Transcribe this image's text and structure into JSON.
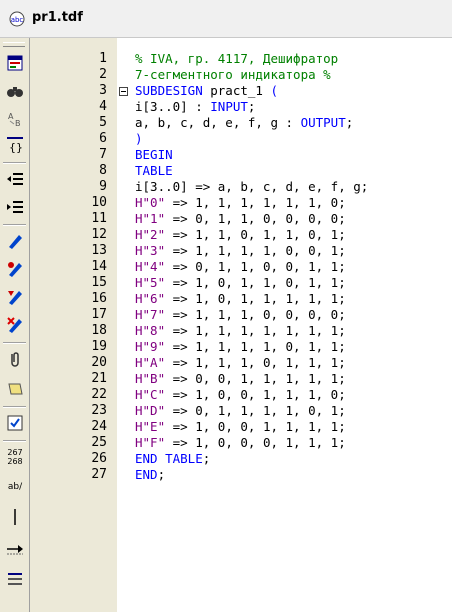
{
  "window": {
    "title": "pr1.tdf"
  },
  "toolbar": {
    "icons": [
      "document-icon",
      "find-icon",
      "find-replace-icon",
      "brackets-icon",
      "indent-icon",
      "unindent-icon",
      "pen-icon",
      "symbol-a-icon",
      "symbol-b-icon",
      "delete-icon",
      "clip-icon",
      "scroll-icon",
      "check-icon",
      "counter-icon",
      "ab-icon",
      "divider-icon",
      "arrow-icon",
      "list-icon"
    ],
    "counter_top": "267",
    "counter_bottom": "268",
    "ab_label": "ab/"
  },
  "editor": {
    "lines": [
      {
        "num": "1",
        "text": "% IVA, гр. 4117, Дешифратор"
      },
      {
        "num": "2",
        "text": "7-сегментного индикатора %"
      },
      {
        "num": "3",
        "text": "SUBDESIGN pract_1 ("
      },
      {
        "num": "4",
        "text": "i[3..0] : INPUT;"
      },
      {
        "num": "5",
        "text": "a, b, c, d, e, f, g : OUTPUT;"
      },
      {
        "num": "6",
        "text": ")"
      },
      {
        "num": "7",
        "text": "BEGIN"
      },
      {
        "num": "8",
        "text": "TABLE"
      },
      {
        "num": "9",
        "text": "i[3..0] => a, b, c, d, e, f, g;"
      },
      {
        "num": "10",
        "text": "H\"0\" => 1, 1, 1, 1, 1, 1, 0;"
      },
      {
        "num": "11",
        "text": "H\"1\" => 0, 1, 1, 0, 0, 0, 0;"
      },
      {
        "num": "12",
        "text": "H\"2\" => 1, 1, 0, 1, 1, 0, 1;"
      },
      {
        "num": "13",
        "text": "H\"3\" => 1, 1, 1, 1, 0, 0, 1;"
      },
      {
        "num": "14",
        "text": "H\"4\" => 0, 1, 1, 0, 0, 1, 1;"
      },
      {
        "num": "15",
        "text": "H\"5\" => 1, 0, 1, 1, 0, 1, 1;"
      },
      {
        "num": "16",
        "text": "H\"6\" => 1, 0, 1, 1, 1, 1, 1;"
      },
      {
        "num": "17",
        "text": "H\"7\" => 1, 1, 1, 0, 0, 0, 0;"
      },
      {
        "num": "18",
        "text": "H\"8\" => 1, 1, 1, 1, 1, 1, 1;"
      },
      {
        "num": "19",
        "text": "H\"9\" => 1, 1, 1, 1, 0, 1, 1;"
      },
      {
        "num": "20",
        "text": "H\"A\" => 1, 1, 1, 0, 1, 1, 1;"
      },
      {
        "num": "21",
        "text": "H\"B\" => 0, 0, 1, 1, 1, 1, 1;"
      },
      {
        "num": "22",
        "text": "H\"C\" => 1, 0, 0, 1, 1, 1, 0;"
      },
      {
        "num": "23",
        "text": "H\"D\" => 0, 1, 1, 1, 1, 0, 1;"
      },
      {
        "num": "24",
        "text": "H\"E\" => 1, 0, 0, 1, 1, 1, 1;"
      },
      {
        "num": "25",
        "text": "H\"F\" => 1, 0, 0, 0, 1, 1, 1;"
      },
      {
        "num": "26",
        "text": "END TABLE;"
      },
      {
        "num": "27",
        "text": "END;"
      }
    ]
  },
  "colors": {
    "comment": "#008000",
    "keyword": "#0000ff",
    "text": "#000000",
    "string": "#800080"
  }
}
